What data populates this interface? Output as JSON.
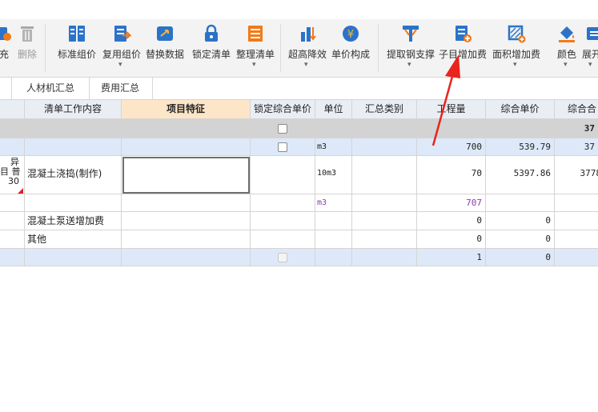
{
  "toolbar": {
    "items": [
      {
        "label": "充",
        "icon": "fill-icon",
        "dropdown": false,
        "disabled": false
      },
      {
        "label": "删除",
        "icon": "trash-icon",
        "dropdown": false,
        "disabled": true
      },
      {
        "label": "标准组价",
        "icon": "standard-price-icon",
        "dropdown": false,
        "disabled": false
      },
      {
        "label": "复用组价",
        "icon": "reuse-price-icon",
        "dropdown": true,
        "disabled": false
      },
      {
        "label": "替换数据",
        "icon": "replace-data-icon",
        "dropdown": false,
        "disabled": false
      },
      {
        "label": "锁定清单",
        "icon": "lock-icon",
        "dropdown": false,
        "disabled": false
      },
      {
        "label": "整理清单",
        "icon": "organize-list-icon",
        "dropdown": true,
        "disabled": false
      },
      {
        "label": "超高降效",
        "icon": "height-reduction-icon",
        "dropdown": true,
        "disabled": false
      },
      {
        "label": "单价构成",
        "icon": "price-composition-icon",
        "dropdown": false,
        "disabled": false
      },
      {
        "label": "提取钢支撑",
        "icon": "steel-support-icon",
        "dropdown": true,
        "disabled": false
      },
      {
        "label": "子目增加费",
        "icon": "sub-item-fee-icon",
        "dropdown": false,
        "disabled": false
      },
      {
        "label": "面积增加费",
        "icon": "area-fee-icon",
        "dropdown": true,
        "disabled": false
      },
      {
        "label": "颜色",
        "icon": "paint-bucket-icon",
        "dropdown": true,
        "disabled": false
      },
      {
        "label": "展开",
        "icon": "expand-icon",
        "dropdown": true,
        "disabled": false
      }
    ]
  },
  "tabs": [
    {
      "label": ""
    },
    {
      "label": "人材机汇总"
    },
    {
      "label": "费用汇总"
    }
  ],
  "table": {
    "headers": [
      "",
      "清单工作内容",
      "项目特征",
      "锁定综合单价",
      "单位",
      "汇总类别",
      "工程量",
      "综合单价",
      "综合合"
    ],
    "rows": [
      {
        "c0": "",
        "c1": "",
        "c2": "",
        "unit": "",
        "c5": "",
        "qty": "",
        "price": "",
        "total": "37"
      },
      {
        "c0": "",
        "c1": "",
        "c2": "",
        "unit": "m3",
        "c5": "",
        "qty": "700",
        "price": "539.79",
        "total": "37"
      },
      {
        "c0_line1": "异",
        "c0_line2": "目 普",
        "c0_line3": "30",
        "c1": "混凝土浇捣(制作)",
        "c2": "",
        "unit": "10m3",
        "c5": "",
        "qty": "70",
        "price": "5397.86",
        "total": "3778"
      },
      {
        "c0": "",
        "c1": "",
        "c2": "",
        "unit": "m3",
        "c5": "",
        "qty": "707",
        "price": "",
        "total": ""
      },
      {
        "c0": "",
        "c1": "混凝土泵送增加费",
        "c2": "",
        "unit": "",
        "c5": "",
        "qty": "0",
        "price": "0",
        "total": ""
      },
      {
        "c0": "",
        "c1": "其他",
        "c2": "",
        "unit": "",
        "c5": "",
        "qty": "0",
        "price": "0",
        "total": ""
      },
      {
        "c0": "",
        "c1": "",
        "c2": "",
        "unit": "",
        "c5": "",
        "qty": "1",
        "price": "0",
        "total": ""
      }
    ]
  },
  "colors": {
    "accent_orange": "#f07a1a",
    "icon_blue": "#2b73c9",
    "header_active": "#fde6c8",
    "row_blue": "#dde9f8",
    "row_gray": "#d3d3d3",
    "arrow_red": "#e8241c",
    "unit_purple": "#8a3ab0"
  }
}
